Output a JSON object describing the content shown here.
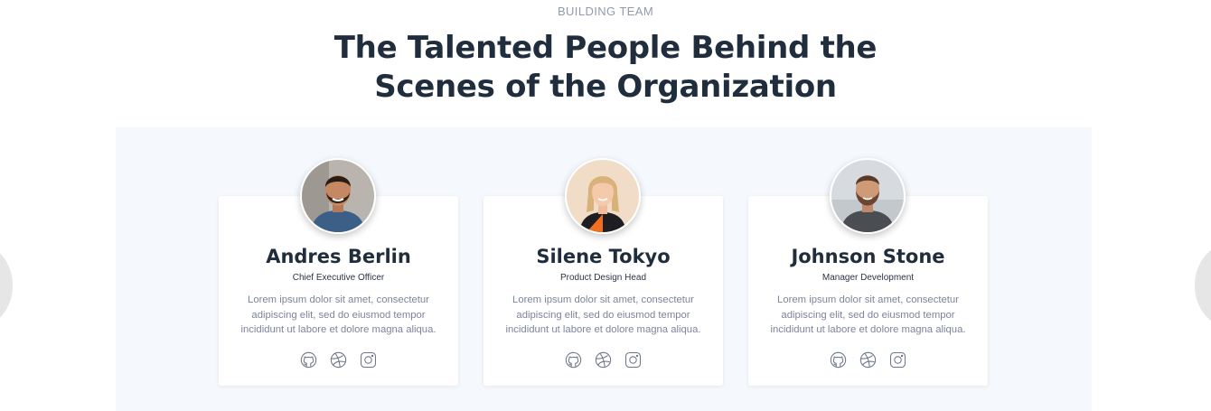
{
  "section": {
    "eyebrow": "BUILDING TEAM",
    "title_line1": "The Talented People Behind the",
    "title_line2": "Scenes of the Organization"
  },
  "team": [
    {
      "name": "Andres Berlin",
      "role": "Chief Executive Officer",
      "bio": "Lorem ipsum dolor sit amet, consectetur adipiscing elit, sed do eiusmod tempor incididunt ut labore et dolore magna aliqua.",
      "avatar": "man-with-dark-beard-photo",
      "socials": [
        "github-icon",
        "dribbble-icon",
        "instagram-icon"
      ]
    },
    {
      "name": "Silene Tokyo",
      "role": "Product Design Head",
      "bio": "Lorem ipsum dolor sit amet, consectetur adipiscing elit, sed do eiusmod tempor incididunt ut labore et dolore magna aliqua.",
      "avatar": "woman-with-blonde-hair-photo",
      "socials": [
        "github-icon",
        "dribbble-icon",
        "instagram-icon"
      ]
    },
    {
      "name": "Johnson Stone",
      "role": "Manager Development",
      "bio": "Lorem ipsum dolor sit amet, consectetur adipiscing elit, sed do eiusmod tempor incididunt ut labore et dolore magna aliqua.",
      "avatar": "man-with-beard-photo",
      "socials": [
        "github-icon",
        "dribbble-icon",
        "instagram-icon"
      ]
    }
  ],
  "colors": {
    "heading": "#1f2d3d",
    "muted": "#8f9bb0",
    "band": "#f5f8fc",
    "icon_stroke": "#6b7688"
  }
}
